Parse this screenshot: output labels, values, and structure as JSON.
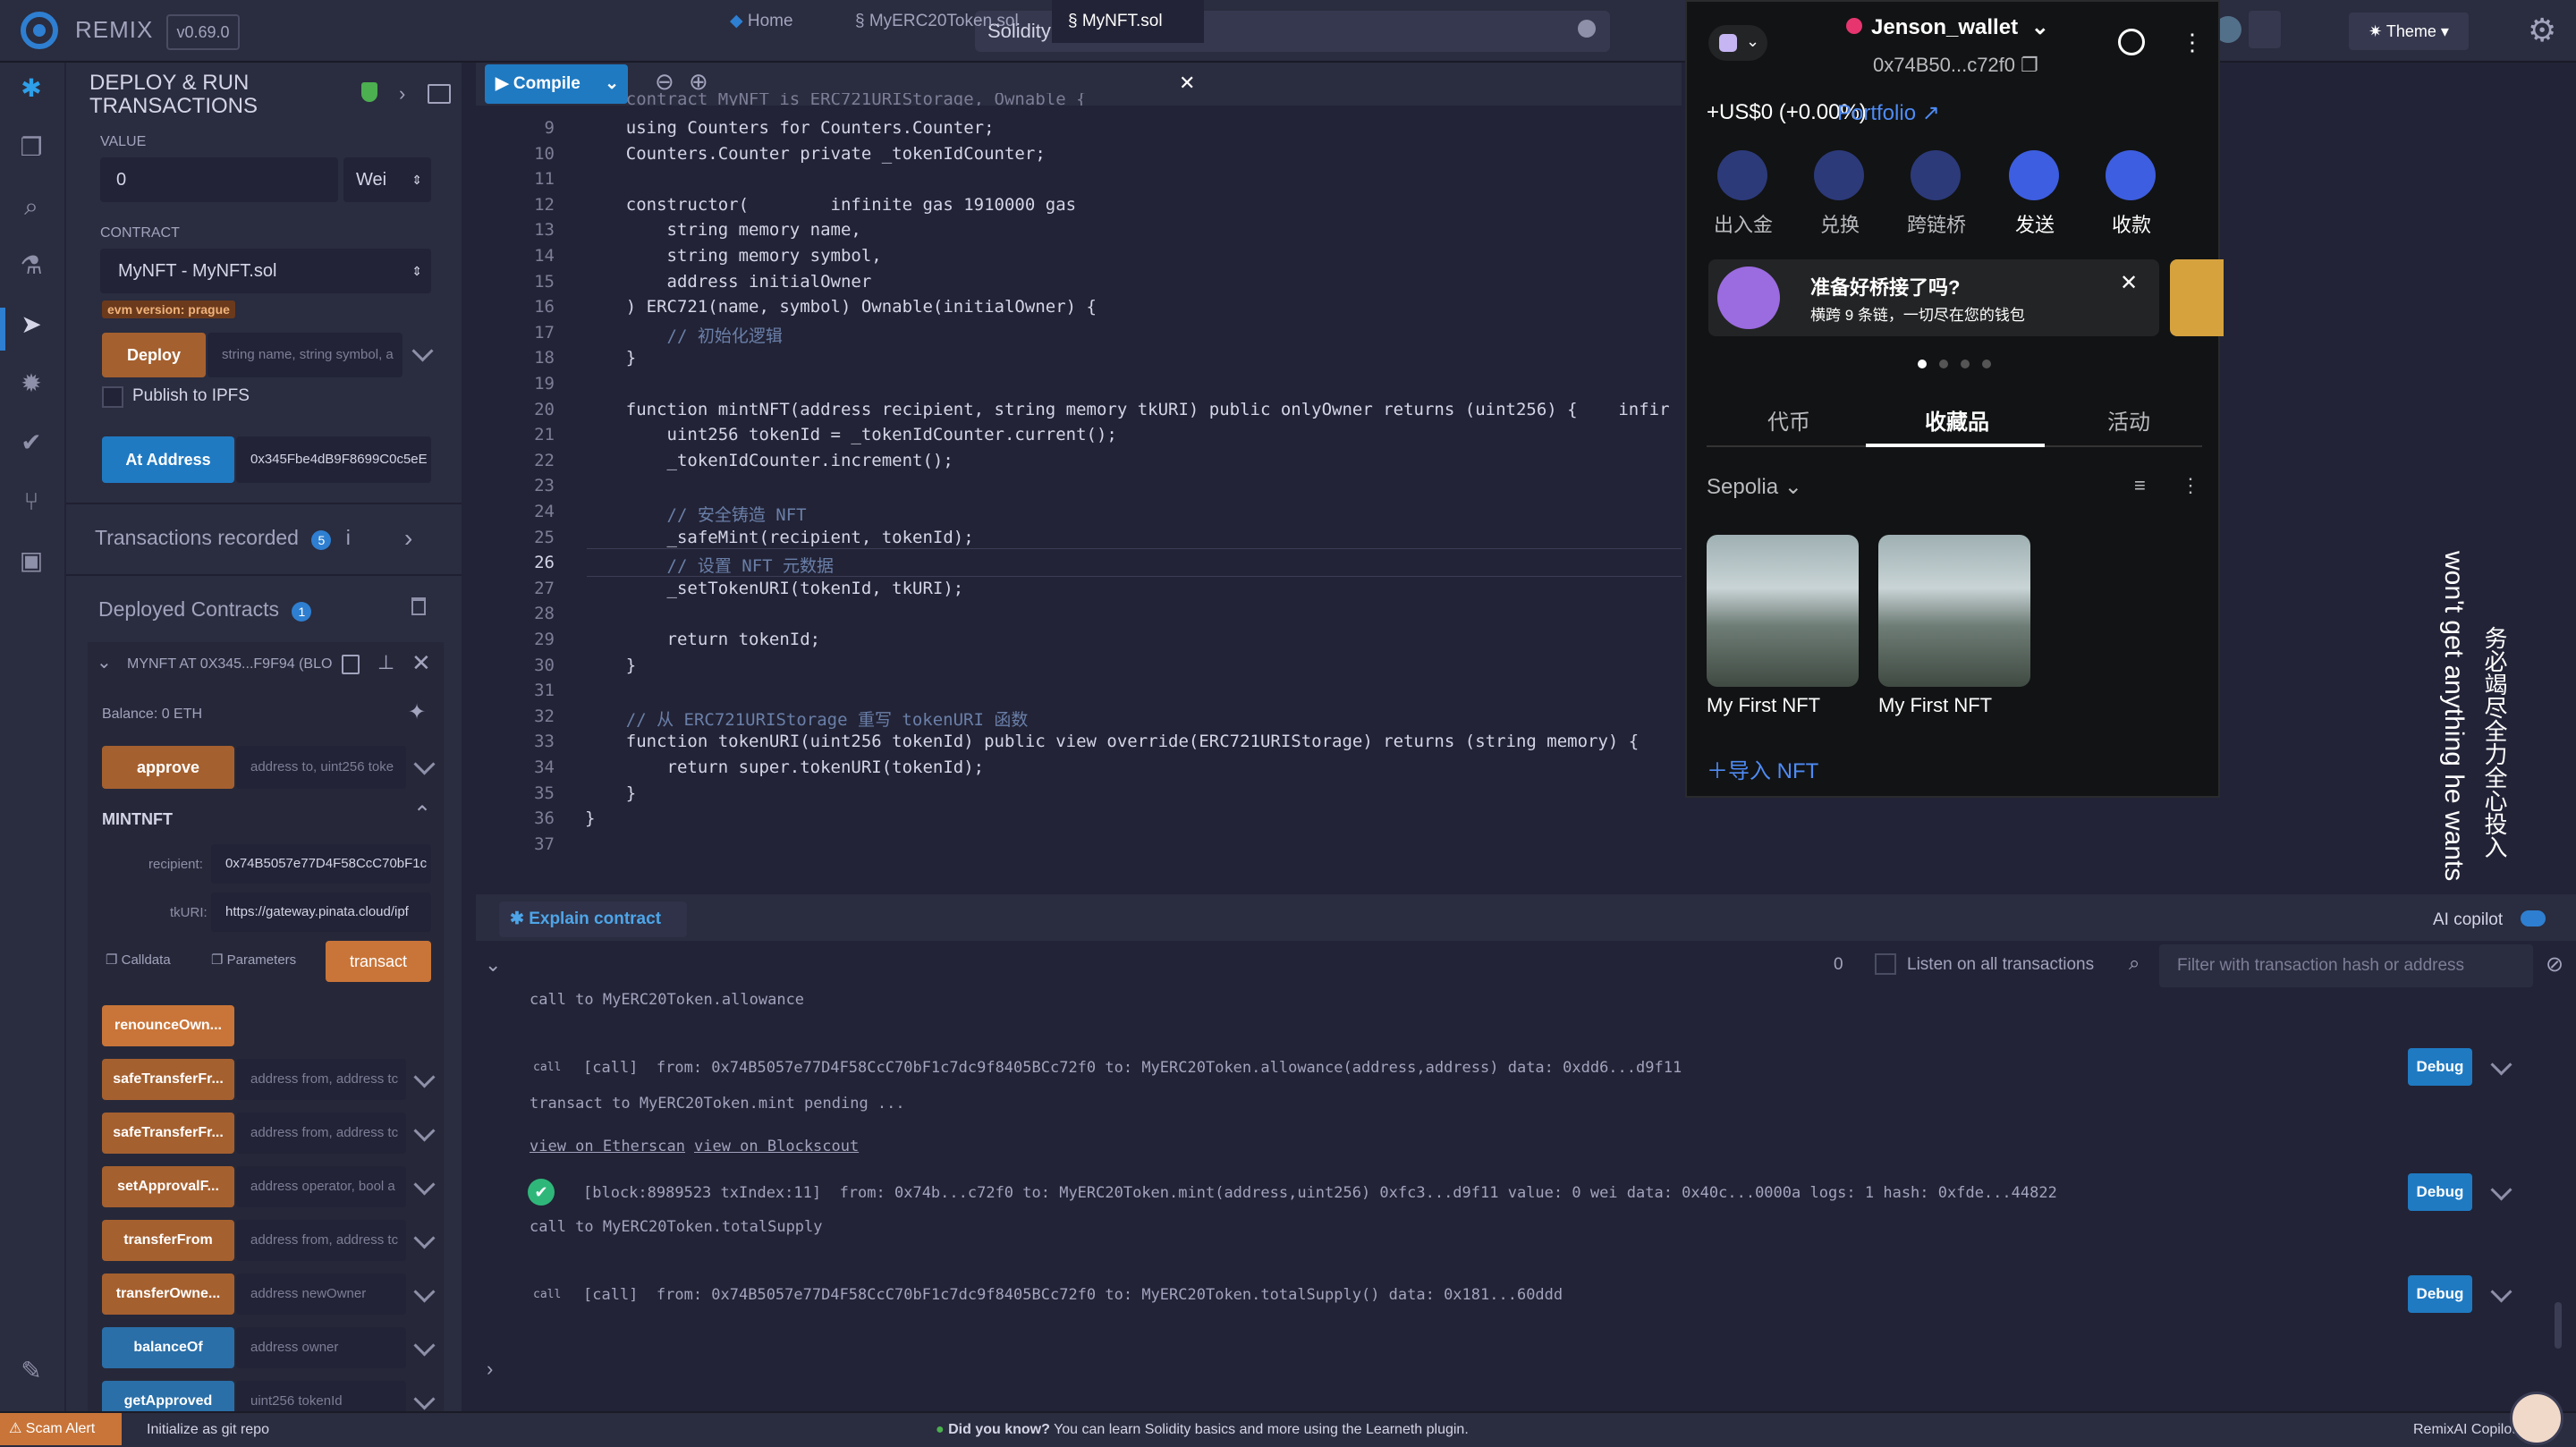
{
  "app": {
    "brand": "REMIX",
    "version": "v0.69.0",
    "search_text": "Solidity Advanced",
    "theme_label": "Theme"
  },
  "panel": {
    "title_line1": "DEPLOY & RUN",
    "title_line2": "TRANSACTIONS",
    "value_label": "VALUE",
    "value": "0",
    "value_unit": "Wei",
    "contract_label": "CONTRACT",
    "contract": "MyNFT - MyNFT.sol",
    "evm_badge": "evm version: prague",
    "deploy_label": "Deploy",
    "deploy_placeholder": "string name, string symbol, a",
    "publish_label": "Publish to IPFS",
    "at_address_label": "At Address",
    "at_address_value": "0x345Fbe4dB9F8699C0c5eE",
    "tx_recorded": "Transactions recorded",
    "tx_count": "5",
    "deployed_title": "Deployed Contracts",
    "deployed_count": "1",
    "instance_name": "MYNFT AT 0X345...F9F94 (BLO",
    "balance": "Balance: 0 ETH",
    "approve_label": "approve",
    "approve_placeholder": "address to, uint256 toke",
    "mintnft_title": "MINTNFT",
    "recipient_label": "recipient:",
    "recipient_value": "0x74B5057e77D4F58CcC70bF1c",
    "tkuri_label": "tkURI:",
    "tkuri_value": "https://gateway.pinata.cloud/ipf",
    "calldata_label": "Calldata",
    "parameters_label": "Parameters",
    "transact_label": "transact",
    "functions": [
      {
        "label": "renounceOwn...",
        "placeholder": ""
      },
      {
        "label": "safeTransferFr...",
        "placeholder": "address from, address tc"
      },
      {
        "label": "safeTransferFr...",
        "placeholder": "address from, address tc"
      },
      {
        "label": "setApprovalF...",
        "placeholder": "address operator, bool a"
      },
      {
        "label": "transferFrom",
        "placeholder": "address from, address tc"
      },
      {
        "label": "transferOwne...",
        "placeholder": "address newOwner"
      },
      {
        "label": "balanceOf",
        "placeholder": "address owner"
      },
      {
        "label": "getApproved",
        "placeholder": "uint256 tokenId"
      }
    ]
  },
  "tabs": {
    "compile": "Compile",
    "home": "Home",
    "file1": "MyERC20Token.sol",
    "file2": "MyNFT.sol"
  },
  "editor": {
    "lines": [
      {
        "n": "9",
        "t": "    using Counters for Counters.Counter;"
      },
      {
        "n": "10",
        "t": "    Counters.Counter private _tokenIdCounter;"
      },
      {
        "n": "11",
        "t": ""
      },
      {
        "n": "12",
        "t": "    constructor(        infinite gas 1910000 gas"
      },
      {
        "n": "13",
        "t": "        string memory name,"
      },
      {
        "n": "14",
        "t": "        string memory symbol,"
      },
      {
        "n": "15",
        "t": "        address initialOwner"
      },
      {
        "n": "16",
        "t": "    ) ERC721(name, symbol) Ownable(initialOwner) {"
      },
      {
        "n": "17",
        "t": "        // 初始化逻辑"
      },
      {
        "n": "18",
        "t": "    }"
      },
      {
        "n": "19",
        "t": ""
      },
      {
        "n": "20",
        "t": "    function mintNFT(address recipient, string memory tkURI) public onlyOwner returns (uint256) {    infir"
      },
      {
        "n": "21",
        "t": "        uint256 tokenId = _tokenIdCounter.current();"
      },
      {
        "n": "22",
        "t": "        _tokenIdCounter.increment();"
      },
      {
        "n": "23",
        "t": ""
      },
      {
        "n": "24",
        "t": "        // 安全铸造 NFT"
      },
      {
        "n": "25",
        "t": "        _safeMint(recipient, tokenId);"
      },
      {
        "n": "26",
        "t": "        // 设置 NFT 元数据"
      },
      {
        "n": "27",
        "t": "        _setTokenURI(tokenId, tkURI);"
      },
      {
        "n": "28",
        "t": ""
      },
      {
        "n": "29",
        "t": "        return tokenId;"
      },
      {
        "n": "30",
        "t": "    }"
      },
      {
        "n": "31",
        "t": ""
      },
      {
        "n": "32",
        "t": "    // 从 ERC721URIStorage 重写 tokenURI 函数"
      },
      {
        "n": "33",
        "t": "    function tokenURI(uint256 tokenId) public view override(ERC721URIStorage) returns (string memory) {"
      },
      {
        "n": "34",
        "t": "        return super.tokenURI(tokenId);"
      },
      {
        "n": "35",
        "t": "    }"
      },
      {
        "n": "36",
        "t": "}"
      },
      {
        "n": "37",
        "t": ""
      }
    ]
  },
  "terminal": {
    "explain": "Explain contract",
    "ai_copilot": "AI copilot",
    "count": "0",
    "listen_label": "Listen on all transactions",
    "filter_placeholder": "Filter with transaction hash or address",
    "line1": "call to MyERC20Token.allowance",
    "line2": "[call]  from: 0x74B5057e77D4F58CcC70bF1c7dc9f8405BCc72f0 to: MyERC20Token.allowance(address,address) data: 0xdd6...d9f11",
    "line3": "transact to MyERC20Token.mint pending ...",
    "link1": "view on Etherscan",
    "link2": "view on Blockscout",
    "line4": "[block:8989523 txIndex:11]  from: 0x74b...c72f0 to: MyERC20Token.mint(address,uint256) 0xfc3...d9f11 value: 0 wei data: 0x40c...0000a logs: 1 hash: 0xfde...44822",
    "line5": "call to MyERC20Token.totalSupply",
    "line6": "[call]  from: 0x74B5057e77D4F58CcC70bF1c7dc9f8405BCc72f0 to: MyERC20Token.totalSupply() data: 0x181...60ddd",
    "debug": "Debug"
  },
  "status": {
    "scam": "Scam Alert",
    "git": "Initialize as git repo",
    "tip_bold": "Did you know?",
    "tip": "You can learn Solidity basics and more using the Learneth plugin.",
    "copilot": "RemixAI Copilot"
  },
  "wallet": {
    "name": "Jenson_wallet",
    "address": "0x74B50...c72f0",
    "balance": "+US$0 (+0.00%)",
    "portfolio": "Portfolio",
    "actions": [
      "出入金",
      "兑换",
      "跨链桥",
      "发送",
      "收款"
    ],
    "banner_title": "准备好桥接了吗?",
    "banner_sub": "横跨 9 条链，一切尽在您的钱包",
    "tabs": [
      "代币",
      "收藏品",
      "活动"
    ],
    "network": "Sepolia",
    "nfts": [
      {
        "name": "My First NFT"
      },
      {
        "name": "My First NFT"
      }
    ],
    "import": "导入 NFT"
  },
  "overlay": {
    "side_en": "won't get anything he wants",
    "side_zh": "务必竭尽全力全心投入"
  },
  "colors": {
    "accent_blue": "#1f7ac2",
    "accent_orange": "#c97539",
    "bg": "#222336",
    "panel": "#2a2c3f"
  }
}
